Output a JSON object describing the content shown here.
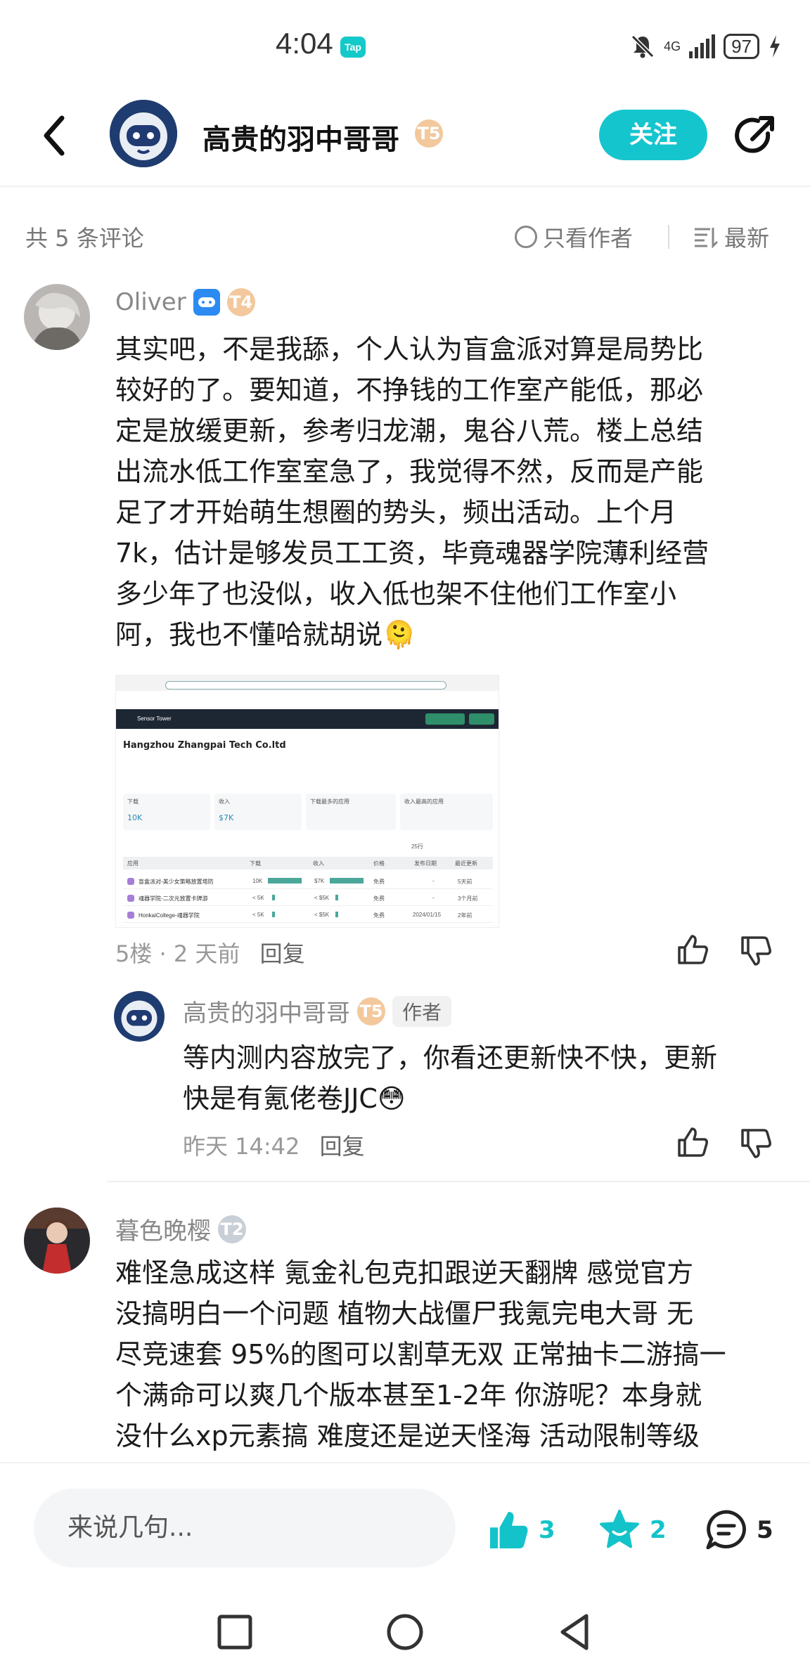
{
  "status_bar": {
    "time": "4:04",
    "app_badge": "Tap",
    "network": "4G",
    "battery": "97"
  },
  "header": {
    "title": "高贵的羽中哥哥",
    "level": "T5",
    "follow_label": "关注"
  },
  "filter": {
    "count_label": "共 5 条评论",
    "only_author_label": "只看作者",
    "sort_label": "最新"
  },
  "comments": [
    {
      "author": "Oliver",
      "level": "T4",
      "text_lines": [
        "其实吧，不是我舔，个人认为盲盒派对算是局势比",
        "较好的了。要知道，不挣钱的工作室产能低，那必",
        "定是放缓更新，参考归龙潮，鬼谷八荒。楼上总结",
        "出流水低工作室室急了，我觉得不然，反而是产能",
        "足了才开始萌生想圈的势头，频出活动。上个月",
        "7k，估计是够发员工工资，毕竟魂器学院薄利经营",
        "多少年了也没似，收入低也架不住他们工作室小",
        "阿，我也不懂哈就胡说🫠"
      ],
      "floor": "5楼",
      "time": "2 天前",
      "reply_label": "回复",
      "embed": {
        "app_name": "Sensor Tower",
        "company": "Hangzhou Zhangpai Tech Co.ltd",
        "download_label": "下载",
        "download_value": "10K",
        "revenue_label": "收入",
        "revenue_value": "$7K",
        "top_download_label": "下载最多的应用",
        "top_revenue_label": "收入最高的应用",
        "row_count": "25行",
        "col_app": "应用",
        "col_download": "下载",
        "col_revenue": "收入",
        "col_price": "价格",
        "col_release": "发布日期",
        "col_update": "最近更新",
        "rows": [
          {
            "name": "盲盒派对-美少女策略放置塔防",
            "dl": "10K",
            "rev": "$7K",
            "price": "免费",
            "release": "-",
            "update": "5天前"
          },
          {
            "name": "魂器学院-二次元放置卡牌游",
            "dl": "< 5K",
            "rev": "< $5K",
            "price": "免费",
            "release": "-",
            "update": "3个月前"
          },
          {
            "name": "HonkaiCollege-魂器学院",
            "dl": "< 5K",
            "rev": "< $5K",
            "price": "免费",
            "release": "2024/01/15",
            "update": "2年前"
          }
        ]
      }
    },
    {
      "author": "高贵的羽中哥哥",
      "level": "T5",
      "author_tag": "作者",
      "text_lines": [
        "等内测内容放完了，你看还更新快不快，更新",
        "快是有氪佬卷JJC😳"
      ],
      "time": "昨天 14:42",
      "reply_label": "回复"
    },
    {
      "author": "暮色晚樱",
      "level": "T2",
      "text_lines": [
        "难怪急成这样 氪金礼包克扣跟逆天翻牌 感觉官方",
        "没搞明白一个问题 植物大战僵尸我氪完电大哥 无",
        "尽竞速套 95%的图可以割草无双 正常抽卡二游搞一",
        "个满命可以爽几个版本甚至1-2年 你游呢？本身就",
        "没什么xp元素搞 难度还是逆天怪海 活动限制等级"
      ]
    }
  ],
  "bottom_bar": {
    "input_placeholder": "来说几句...",
    "like_count": "3",
    "favorite_count": "2",
    "comment_count": "5"
  },
  "colors": {
    "accent": "#15c5ce",
    "text_primary": "#1b1b1b",
    "text_secondary": "#888888"
  },
  "icons": [
    "back-arrow-icon",
    "share-icon",
    "radio-icon",
    "sort-icon",
    "thumb-up-icon",
    "thumb-down-icon",
    "star-icon",
    "comment-icon",
    "nav-square-icon",
    "nav-circle-icon",
    "nav-back-icon"
  ]
}
